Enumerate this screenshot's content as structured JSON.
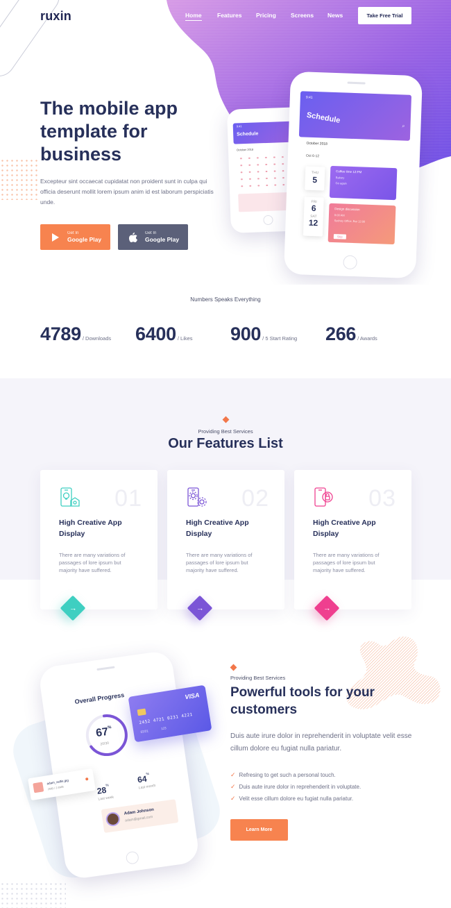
{
  "brand": {
    "name": "ruxin"
  },
  "nav": {
    "items": [
      "Home",
      "Features",
      "Pricing",
      "Screens",
      "News"
    ],
    "cta": "Take Free Trial"
  },
  "hero": {
    "title": "The mobile app template for business",
    "subtitle": "Excepteur sint occaecat cupidatat non proident sunt in culpa qui officia deserunt mollit lorem ipsum anim id est laborum perspiciatis unde.",
    "buttons": [
      {
        "small": "Get In",
        "label": "Google Play",
        "icon": "play-icon"
      },
      {
        "small": "Get In",
        "label": "Google Play",
        "icon": "apple-icon"
      }
    ],
    "phone_large": {
      "time": "9:41",
      "title": "Schedule",
      "month": "October 2018",
      "section": "Oct 6-12",
      "events": [
        {
          "day_name": "THU",
          "day": "5",
          "lines": [
            "Coffee time 12:PM",
            "Bakery",
            "Go again"
          ]
        },
        {
          "day_name": "FRI",
          "day": "6",
          "day_name2": "SAT",
          "day2": "12",
          "lines": [
            "Design discussion",
            "9:00 AM",
            "Sydney Office, Bar 12:00"
          ],
          "action": "Skip"
        }
      ]
    },
    "phone_small": {
      "time": "9:41",
      "title": "Schedule",
      "month": "October 2018"
    }
  },
  "stats": {
    "label": "Numbers Speaks Everything",
    "items": [
      {
        "value": "4789",
        "label": "/ Downloads"
      },
      {
        "value": "6400",
        "label": "/ Likes"
      },
      {
        "value": "900",
        "label": "/ 5 Start Rating"
      },
      {
        "value": "266",
        "label": "/ Awards"
      }
    ]
  },
  "features": {
    "kicker": "Providing Best Services",
    "title": "Our Features List",
    "cards": [
      {
        "num": "01",
        "title": "High Creative App Display",
        "desc": "There are many variations of passages of lore ipsum but majority have suffered.",
        "color": "#3ecfc1",
        "icon": "mobile-idea-icon",
        "arrow": "→"
      },
      {
        "num": "02",
        "title": "High Creative App Display",
        "desc": "There are many variations of passages of lore ipsum but majority have suffered.",
        "color": "#7b55d6",
        "icon": "mobile-settings-icon",
        "arrow": "→"
      },
      {
        "num": "03",
        "title": "High Creative App Display",
        "desc": "There are many variations of passages of lore ipsum but majority have suffered.",
        "color": "#ef3f8f",
        "icon": "mobile-lock-icon",
        "arrow": "→"
      }
    ]
  },
  "tools": {
    "kicker": "Providing Best Services",
    "title": "Powerful tools for your customers",
    "description": "Duis aute irure dolor in reprehenderit in voluptate velit esse cillum dolore eu fugiat nulla pariatur.",
    "checks": [
      "Refresing to get such a personal touch.",
      "Duis aute irure dolor in reprehenderit in voluptate.",
      "Velit esse cillum dolore eu fugiat nulla pariatur."
    ],
    "button": "Learn More",
    "mockup": {
      "title": "Overall Progress",
      "percent": "67",
      "percent_sign": "%",
      "progress": 0.67,
      "fraction": "20/30",
      "card_brand": "VISA",
      "card_number": "2452 4721 0231 4221",
      "card_exp1": "02/21",
      "card_exp2": "123",
      "stat_a": {
        "value": "28",
        "unit": "%",
        "label": "Last week"
      },
      "stat_b": {
        "value": "64",
        "unit": "%",
        "label": "Last month"
      },
      "file_name": "adam_selfie.jpg",
      "file_size": "2MB / 2.6MB",
      "user_name": "Adam Johnson",
      "user_email": "adam@gmail.com"
    }
  },
  "colors": {
    "accent": "#f7834f",
    "navy": "#27305a",
    "purple_start": "#c18ce8",
    "purple_end": "#6d4fe6"
  }
}
